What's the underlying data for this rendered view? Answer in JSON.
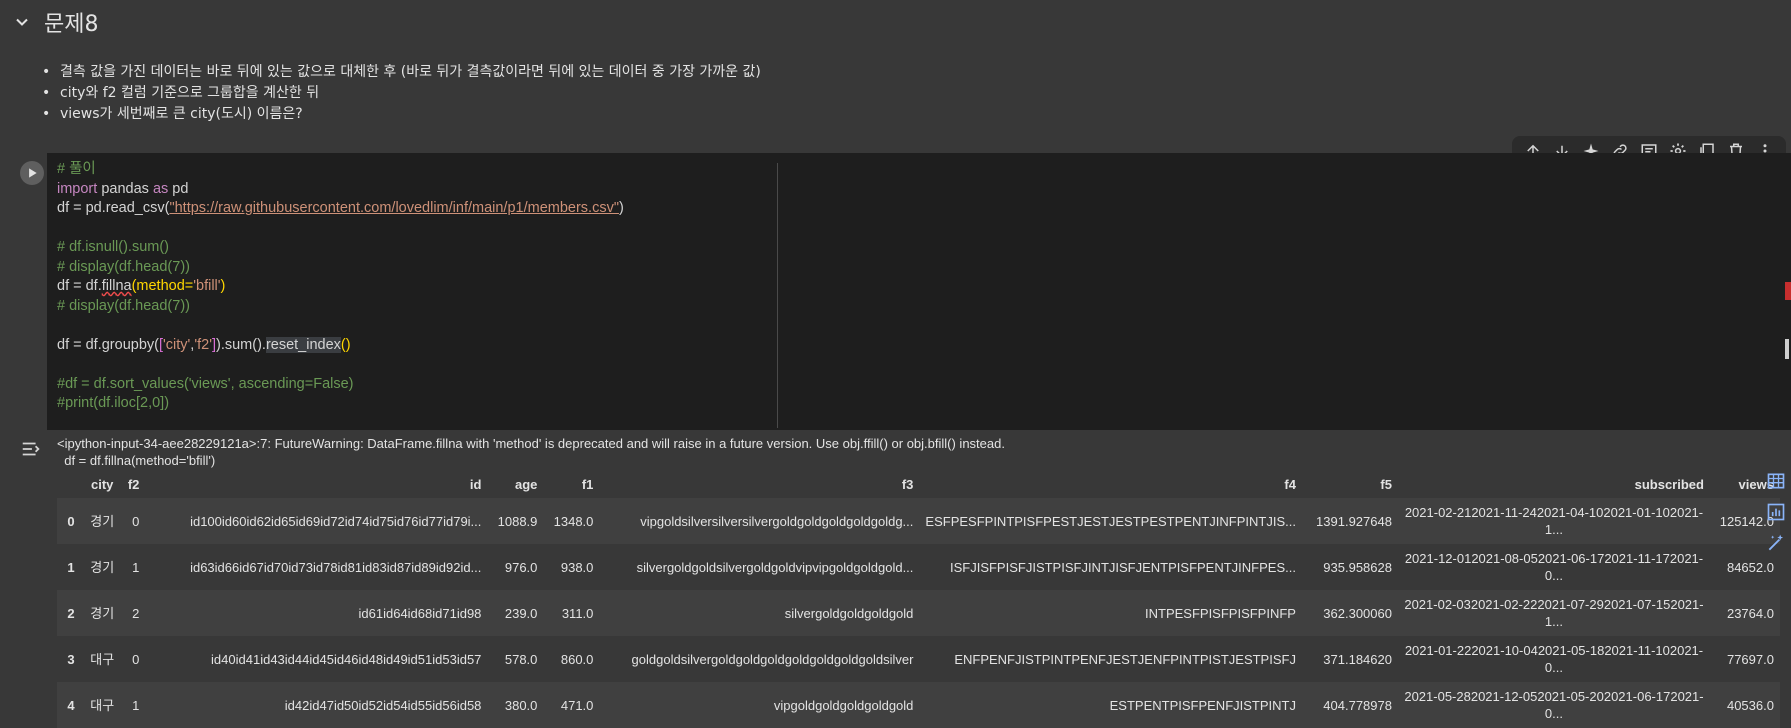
{
  "section": {
    "title": "문제8"
  },
  "bullets": [
    "결측 값을 가진 데이터는 바로 뒤에 있는 값으로 대체한 후 (바로 뒤가 결측값이라면 뒤에 있는 데이터 중 가장 가까운 값)",
    "city와 f2 컬럼 기준으로 그룹합을 계산한 뒤",
    "views가 세번째로 큰 city(도시) 이름은?"
  ],
  "toolbar": {
    "icons": [
      "arrow-up-icon",
      "arrow-down-icon",
      "sparkle-icon",
      "link-icon",
      "comment-icon",
      "gear-icon",
      "mirror-icon",
      "trash-icon",
      "more-icon"
    ]
  },
  "code": {
    "l1": "# 풀이",
    "l2_kw": "import",
    "l2_rest": " pandas ",
    "l2_kw2": "as",
    "l2_end": " pd",
    "l3_a": "df = pd.read_csv(",
    "l3_url": "\"https://raw.githubusercontent.com/lovedlim/inf/main/p1/members.csv\"",
    "l3_b": ")",
    "l5": "# df.isnull().sum()",
    "l6": "# display(df.head(7))",
    "l7_a": "df = df.",
    "l7_err": "fillna",
    "l7_b": "(method=",
    "l7_str": "'bfill'",
    "l7_c": ")",
    "l8": "# display(df.head(7))",
    "l10_a": "df = df.groupby(",
    "l10_b": "[",
    "l10_s1": "'city'",
    "l10_comma": ",",
    "l10_s2": "'f2'",
    "l10_c": "]",
    "l10_d": ").sum().",
    "l10_hl": "reset_index",
    "l10_e": "()",
    "l12": "#df = df.sort_values('views', ascending=False)",
    "l13": "#print(df.iloc[2,0])"
  },
  "output": {
    "warning_line1": "<ipython-input-34-aee28229121a>:7: FutureWarning: DataFrame.fillna with 'method' is deprecated and will raise in a future version. Use obj.ffill() or obj.bfill() instead.",
    "warning_line2": "  df = df.fillna(method='bfill')"
  },
  "table": {
    "columns": [
      "",
      "city",
      "f2",
      "id",
      "age",
      "f1",
      "f3",
      "f4",
      "f5",
      "subscribed",
      "views"
    ],
    "rows": [
      [
        "0",
        "경기",
        "0",
        "id100id60id62id65id69id72id74id75id76id77id79i...",
        "1088.9",
        "1348.0",
        "vipgoldsilversilversilvergoldgoldgoldgoldgoldg...",
        "ESFPESFPINTPISFPESTJESTJESTPESTPENTJINFPINTJIS...",
        "1391.927648",
        "2021-02-212021-11-242021-04-102021-01-102021-1...",
        "125142.0"
      ],
      [
        "1",
        "경기",
        "1",
        "id63id66id67id70id73id78id81id83id87id89id92id...",
        "976.0",
        "938.0",
        "silvergoldgoldsilvergoldgoldvipvipgoldgoldgold...",
        "ISFJISFPISFJISTPISFJINTJISFJENTPISFPENTJINFPES...",
        "935.958628",
        "2021-12-012021-08-052021-06-172021-11-172021-0...",
        "84652.0"
      ],
      [
        "2",
        "경기",
        "2",
        "id61id64id68id71id98",
        "239.0",
        "311.0",
        "silvergoldgoldgoldgold",
        "INTPESFPISFPISFPINFP",
        "362.300060",
        "2021-02-032021-02-222021-07-292021-07-152021-1...",
        "23764.0"
      ],
      [
        "3",
        "대구",
        "0",
        "id40id41id43id44id45id46id48id49id51id53id57",
        "578.0",
        "860.0",
        "goldgoldsilvergoldgoldgoldgoldgoldgoldgoldsilver",
        "ENFPENFJISTPINTPENFJESTJENFPINTPISTJESTPISFJ",
        "371.184620",
        "2021-01-222021-10-042021-05-182021-11-102021-0...",
        "77697.0"
      ],
      [
        "4",
        "대구",
        "1",
        "id42id47id50id52id54id55id56id58",
        "380.0",
        "471.0",
        "vipgoldgoldgoldgoldgold",
        "ESTPENTPISFPENFJISTPINTJ",
        "404.778978",
        "2021-05-282021-12-052021-05-202021-06-172021-0...",
        "40536.0"
      ]
    ]
  },
  "side_icons": [
    "table-icon",
    "chart-icon",
    "magic-wand-icon"
  ]
}
